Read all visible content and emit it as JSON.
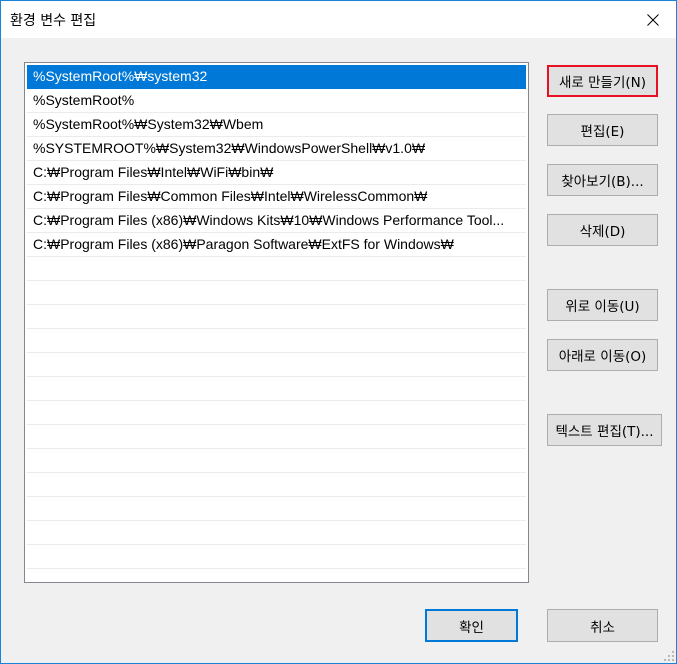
{
  "window": {
    "title": "환경 변수 편집",
    "close_icon": "close-icon"
  },
  "list": {
    "selected_index": 0,
    "items": [
      "%SystemRoot%₩system32",
      "%SystemRoot%",
      "%SystemRoot%₩System32₩Wbem",
      "%SYSTEMROOT%₩System32₩WindowsPowerShell₩v1.0₩",
      "C:₩Program Files₩Intel₩WiFi₩bin₩",
      "C:₩Program Files₩Common Files₩Intel₩WirelessCommon₩",
      "C:₩Program Files (x86)₩Windows Kits₩10₩Windows Performance Tool...",
      "C:₩Program Files (x86)₩Paragon Software₩ExtFS for Windows₩"
    ],
    "empty_rows": 13
  },
  "buttons": {
    "new": "새로 만들기(N)",
    "edit": "편집(E)",
    "browse": "찾아보기(B)...",
    "delete": "삭제(D)",
    "move_up": "위로 이동(U)",
    "move_down": "아래로 이동(O)",
    "edit_text": "텍스트 편집(T)...",
    "ok": "확인",
    "cancel": "취소"
  },
  "colors": {
    "selection": "#0078d7",
    "highlight_border": "#e81123",
    "window_border": "#1883d7"
  }
}
